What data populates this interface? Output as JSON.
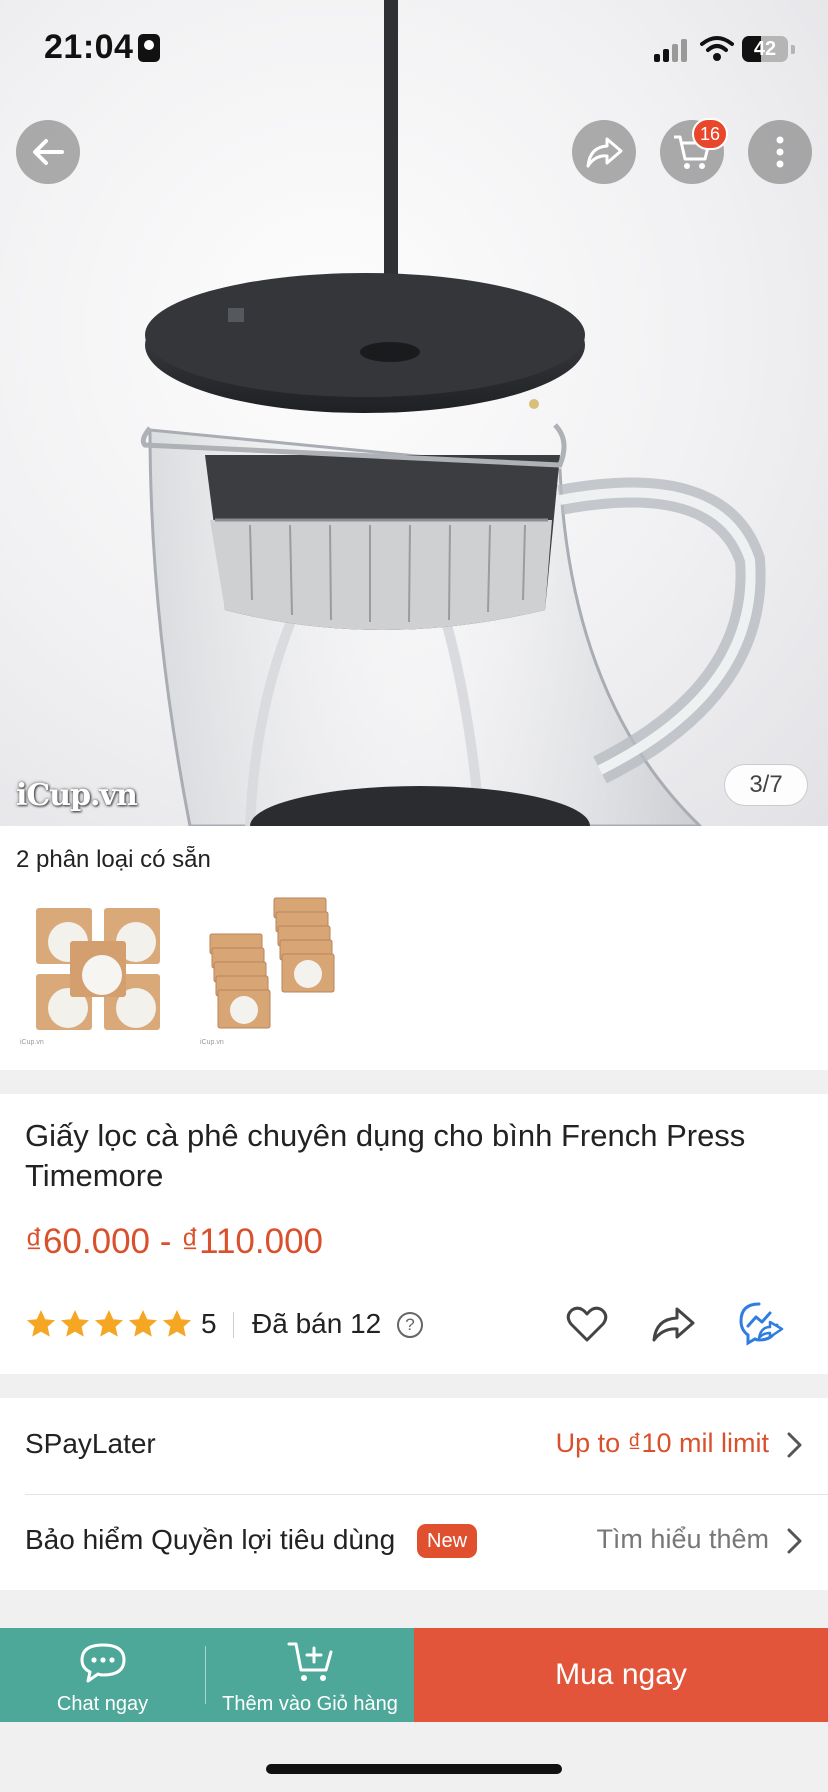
{
  "status_bar": {
    "time": "21:04",
    "battery": "42"
  },
  "header": {
    "back_icon": "arrow-left-icon",
    "share_icon": "share-icon",
    "cart_icon": "cart-icon",
    "cart_count": "16",
    "more_icon": "more-vertical-icon"
  },
  "gallery": {
    "watermark": "iCup.vn",
    "counter": "3/7"
  },
  "variants": {
    "title": "2 phân loại có sẵn",
    "items": [
      {
        "image": "filter-paper-5-packs",
        "tag": "iCup.vn"
      },
      {
        "image": "filter-paper-10-packs",
        "tag": "iCup.vn"
      }
    ]
  },
  "product": {
    "title": "Giấy lọc cà phê chuyên dụng cho bình French Press Timemore",
    "price": "₫60.000 - ₫110.000",
    "rating": "5",
    "sold": "Đã bán 12",
    "star_count": 5
  },
  "rows": [
    {
      "label": "SPayLater",
      "value": "Up to ₫10 mil limit",
      "value_color": "#d9512c"
    },
    {
      "label": "Bảo hiểm Quyền lợi tiêu dùng",
      "badge": "New",
      "value": "Tìm hiểu thêm",
      "value_color": "#777777"
    }
  ],
  "bottom_bar": {
    "chat_label": "Chat ngay",
    "add_cart_label": "Thêm vào Giỏ hàng",
    "buy_label": "Mua ngay"
  },
  "colors": {
    "accent": "#e2553a",
    "teal": "#4ea899",
    "price": "#d9512c",
    "star": "#f5a623"
  }
}
